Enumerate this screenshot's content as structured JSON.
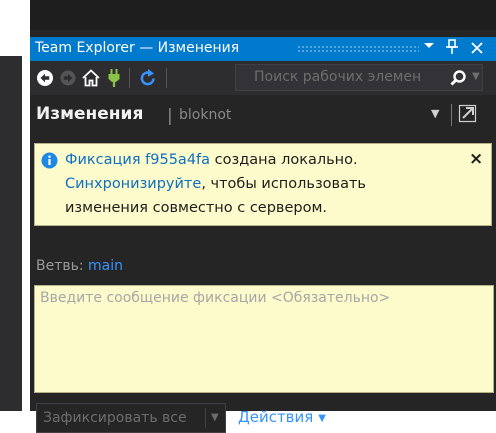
{
  "window": {
    "title": "Team Explorer — Изменения",
    "dropdown_icon": "chevron-down",
    "pin_icon": "pin",
    "close_icon": "close",
    "accent": "#007acc"
  },
  "toolbar": {
    "tools": [
      "back-arrow",
      "forward-arrow",
      "home",
      "plug-connect",
      "refresh"
    ],
    "search_placeholder": "Поиск рабочих элемен"
  },
  "header": {
    "title": "Изменения",
    "separator": "|",
    "repo": "bloknot"
  },
  "notification": {
    "icon": "info",
    "line1_link": "Фиксация f955a4fa",
    "line1_text": " создана локально.",
    "line2_link": "Синхронизируйте",
    "line2_text": ", чтобы использовать",
    "line3": "изменения совместно с сервером.",
    "close_label": "×"
  },
  "branch": {
    "label": "Ветвь:",
    "value": "main"
  },
  "commit": {
    "message_placeholder": "Введите сообщение фиксации <Обязательно>",
    "message_value": ""
  },
  "footer": {
    "commit_all_label": "Зафиксировать все",
    "actions_label": "Действия"
  }
}
